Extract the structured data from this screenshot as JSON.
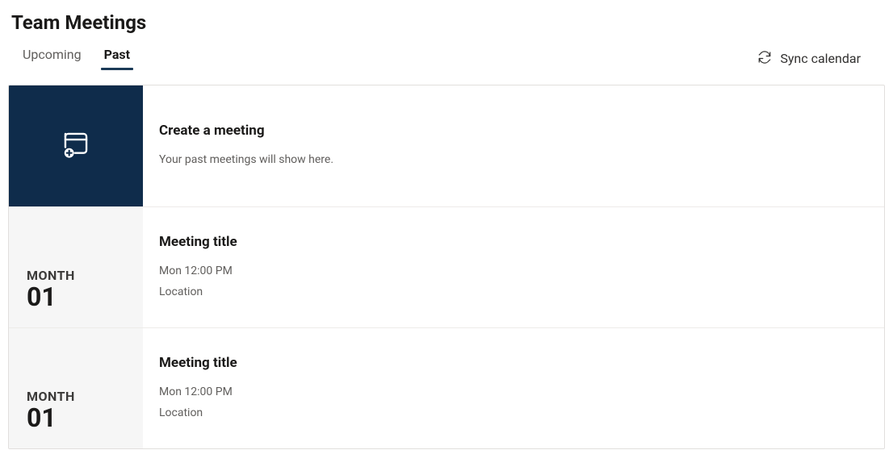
{
  "page_title": "Team Meetings",
  "tabs": {
    "upcoming": "Upcoming",
    "past": "Past",
    "active": "past"
  },
  "sync_label": "Sync calendar",
  "create": {
    "title": "Create a meeting",
    "subtitle": "Your past meetings will show here."
  },
  "meetings": [
    {
      "month": "MONTH",
      "day": "01",
      "title": "Meeting title",
      "time": "Mon 12:00 PM",
      "location": "Location"
    },
    {
      "month": "MONTH",
      "day": "01",
      "title": "Meeting title",
      "time": "Mon 12:00 PM",
      "location": "Location"
    }
  ]
}
